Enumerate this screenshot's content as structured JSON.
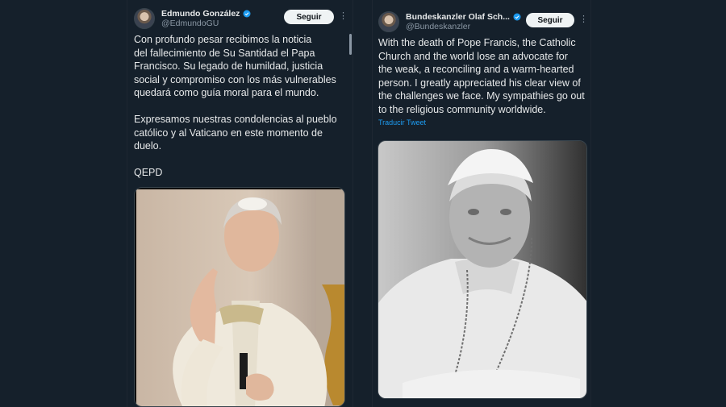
{
  "tweets": [
    {
      "author": "Edmundo González",
      "handle": "@EdmundoGU",
      "follow_label": "Seguir",
      "more_label": "⋮",
      "body": "Con profundo pesar recibimos la noticia\ndel fallecimiento de Su Santidad el Papa\nFrancisco. Su legado de humildad, justicia\nsocial y compromiso con los más vulnerables\nquedará como guía moral para el mundo.\n\nExpresamos nuestras condolencias al pueblo\ncatólico y al Vaticano en este momento de\nduelo.\n\nQEPD",
      "photo_icon": "pope-waving-photo"
    },
    {
      "author": "Bundeskanzler Olaf Sch...",
      "handle": "@Bundeskanzler",
      "follow_label": "Seguir",
      "more_label": "⋮",
      "body": "With the death of Pope Francis, the Catholic\nChurch and the world lose an advocate for\nthe weak, a reconciling and a warm-hearted\nperson. I greatly appreciated his clear view of\nthe challenges we face. My sympathies go out\nto the religious community worldwide.",
      "translate_label": "Traducir Tweet",
      "photo_icon": "pope-portrait-bw-photo"
    }
  ],
  "colors": {
    "background": "#15202b",
    "verified": "#1d9bf0",
    "link": "#1d9bf0"
  }
}
